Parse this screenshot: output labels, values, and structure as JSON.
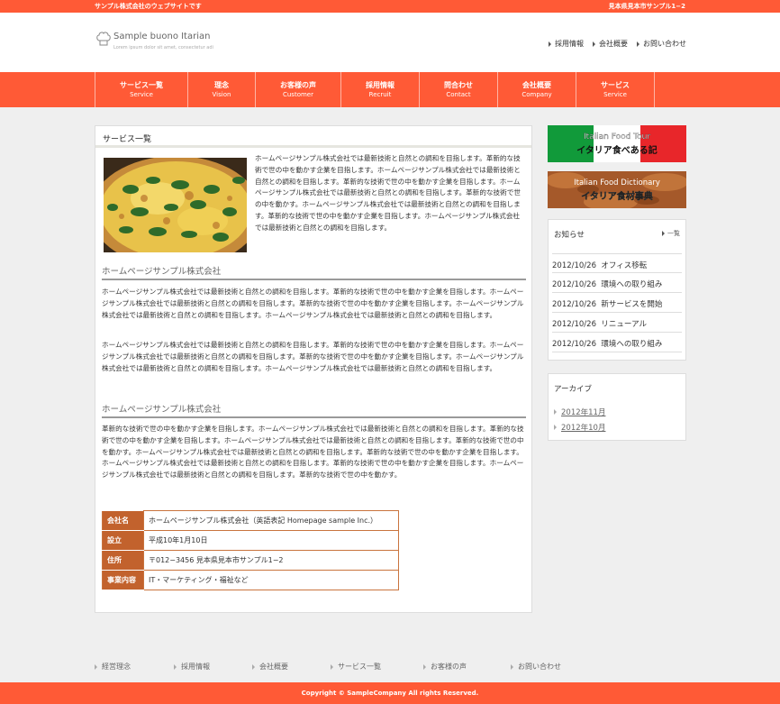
{
  "topbar": {
    "left": "サンプル株式会社のウェブサイトです",
    "right": "見本県見本市サンプル1−2"
  },
  "logo": {
    "name": "Sample buono Itarian",
    "sub": "Lorem ipsum dolor sit amet, consectetur adi"
  },
  "header_nav": [
    "採用情報",
    "会社概要",
    "お問い合わせ"
  ],
  "global_nav": [
    {
      "jp": "サービス一覧",
      "en": "Service"
    },
    {
      "jp": "理念",
      "en": "Vision"
    },
    {
      "jp": "お客様の声",
      "en": "Customer"
    },
    {
      "jp": "採用情報",
      "en": "Recruit"
    },
    {
      "jp": "問合わせ",
      "en": "Contact"
    },
    {
      "jp": "会社概要",
      "en": "Company"
    },
    {
      "jp": "サービス",
      "en": "Service"
    }
  ],
  "main": {
    "title": "サービス一覧",
    "intro": "ホームページサンプル株式会社では最新技術と自然との調和を目指します。革新的な技術で世の中を動かす企業を目指します。ホームページサンプル株式会社では最新技術と自然との調和を目指します。革新的な技術で世の中を動かす企業を目指します。ホームページサンプル株式会社では最新技術と自然との調和を目指します。革新的な技術で世の中を動かす。ホームページサンプル株式会社では最新技術と自然との調和を目指します。革新的な技術で世の中を動かす企業を目指します。ホームページサンプル株式会社では最新技術と自然との調和を目指します。",
    "section1_title": "ホームページサンプル株式会社",
    "section1_p1": "ホームページサンプル株式会社では最新技術と自然との調和を目指します。革新的な技術で世の中を動かす企業を目指します。ホームページサンプル株式会社では最新技術と自然との調和を目指します。革新的な技術で世の中を動かす企業を目指します。ホームページサンプル株式会社では最新技術と自然との調和を目指します。ホームページサンプル株式会社では最新技術と自然との調和を目指します。",
    "section1_p2": "ホームページサンプル株式会社では最新技術と自然との調和を目指します。革新的な技術で世の中を動かす企業を目指します。ホームページサンプル株式会社では最新技術と自然との調和を目指します。革新的な技術で世の中を動かす企業を目指します。ホームページサンプル株式会社では最新技術と自然との調和を目指します。ホームページサンプル株式会社では最新技術と自然との調和を目指します。",
    "section2_title": "ホームページサンプル株式会社",
    "section2_p1": "革新的な技術で世の中を動かす企業を目指します。ホームページサンプル株式会社では最新技術と自然との調和を目指します。革新的な技術で世の中を動かす企業を目指します。ホームページサンプル株式会社では最新技術と自然との調和を目指します。革新的な技術で世の中を動かす。ホームページサンプル株式会社では最新技術と自然との調和を目指します。革新的な技術で世の中を動かす企業を目指します。ホームページサンプル株式会社では最新技術と自然との調和を目指します。革新的な技術で世の中を動かす企業を目指します。ホームページサンプル株式会社では最新技術と自然との調和を目指します。革新的な技術で世の中を動かす。",
    "company_table": [
      {
        "key": "会社名",
        "value": "ホームページサンプル株式会社（英語表記 Homepage sample Inc.）"
      },
      {
        "key": "設立",
        "value": "平成10年1月10日"
      },
      {
        "key": "住所",
        "value": "〒012−3456 見本県見本市サンプル1−2"
      },
      {
        "key": "事業内容",
        "value": "IT・マーケティング・福祉など"
      }
    ]
  },
  "banners": [
    {
      "en": "Italian Food Tour",
      "jp": "イタリア食べある記"
    },
    {
      "en": "Italian Food Dictionary",
      "jp": "イタリア食材事典"
    }
  ],
  "news": {
    "title": "お知らせ",
    "more": "一覧",
    "items": [
      {
        "date": "2012/10/26",
        "text": "オフィス移転"
      },
      {
        "date": "2012/10/26",
        "text": "環境への取り組み"
      },
      {
        "date": "2012/10/26",
        "text": "新サービスを開始"
      },
      {
        "date": "2012/10/26",
        "text": "リニューアル"
      },
      {
        "date": "2012/10/26",
        "text": "環境への取り組み"
      }
    ]
  },
  "archive": {
    "title": "アーカイブ",
    "items": [
      "2012年11月",
      "2012年10月"
    ]
  },
  "footer_nav": [
    "経営理念",
    "採用情報",
    "会社概要",
    "サービス一覧",
    "お客様の声",
    "お問い合わせ"
  ],
  "copyright": "Copyright © SampleCompany All rights Reserved.",
  "colors": {
    "accent": "#ff5a36",
    "table_key": "#c2622d"
  }
}
